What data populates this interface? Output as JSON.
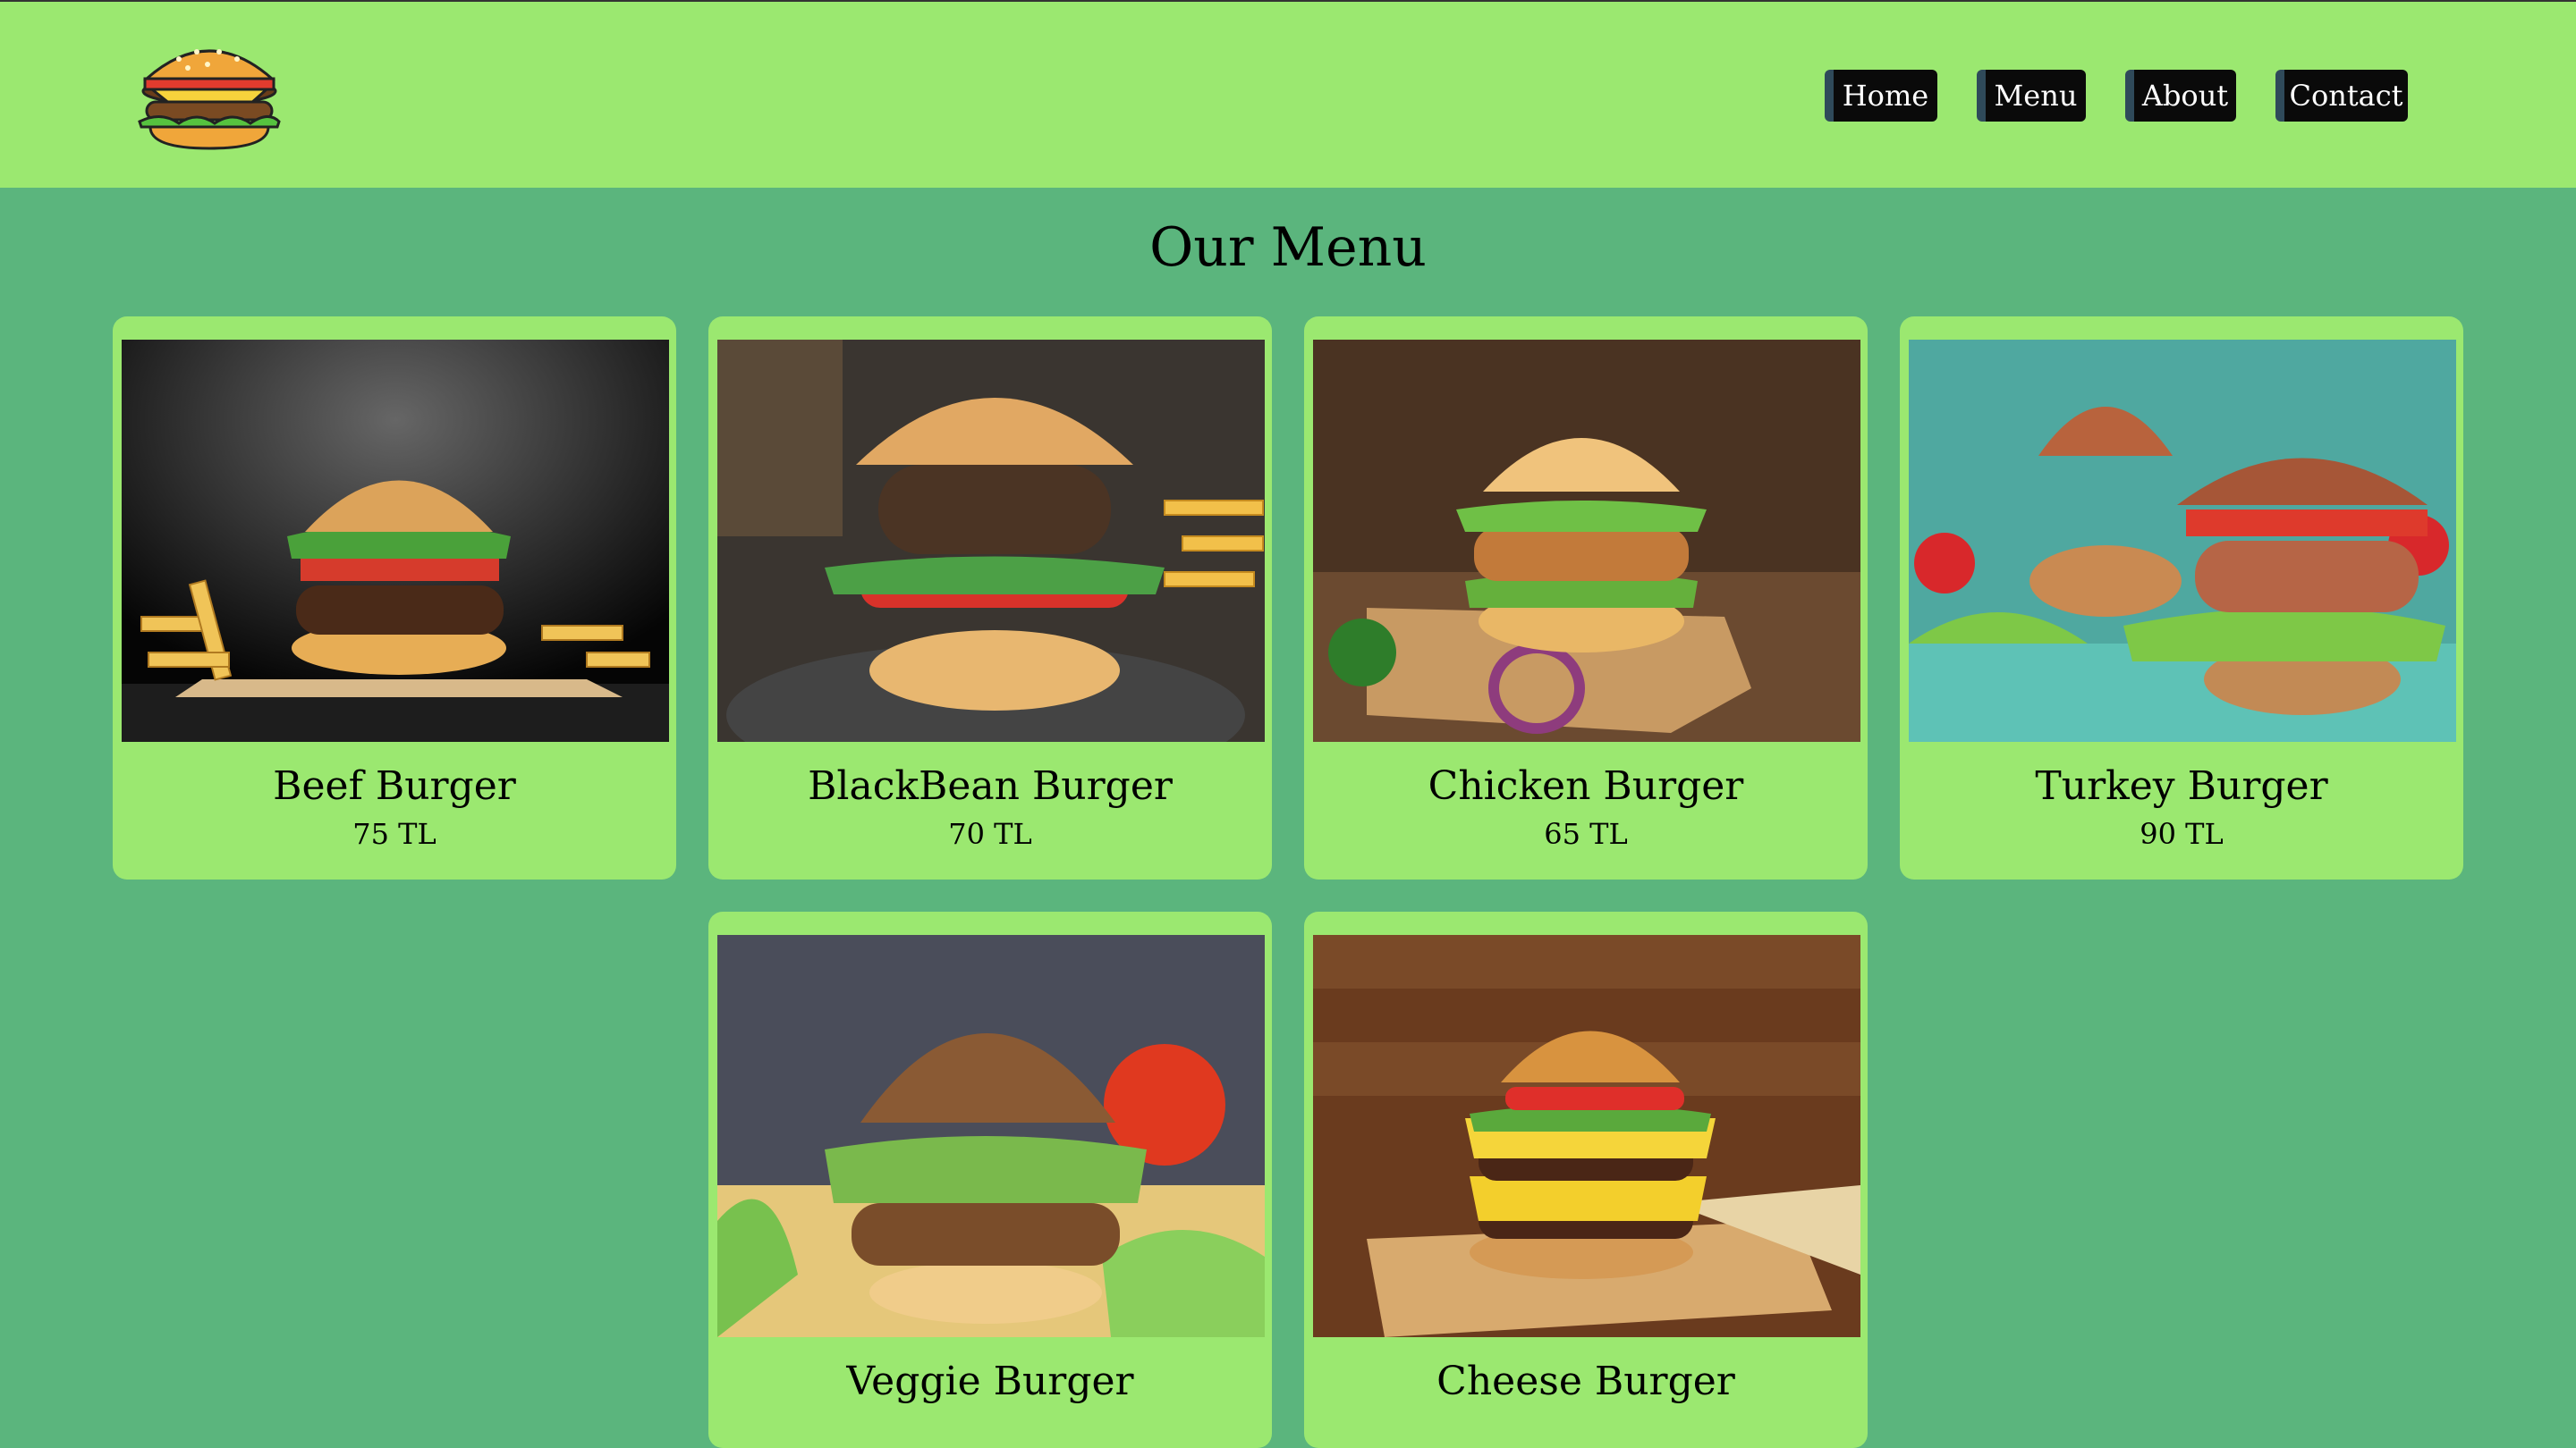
{
  "nav": {
    "items": [
      "Home",
      "Menu",
      "About",
      "Contact"
    ]
  },
  "page_title": "Our Menu",
  "menu": [
    {
      "name": "Beef Burger",
      "price": "75 TL"
    },
    {
      "name": "BlackBean Burger",
      "price": "70 TL"
    },
    {
      "name": "Chicken Burger",
      "price": "65 TL"
    },
    {
      "name": "Turkey Burger",
      "price": "90 TL"
    },
    {
      "name": "Veggie Burger",
      "price": ""
    },
    {
      "name": "Cheese Burger",
      "price": ""
    }
  ],
  "colors": {
    "header": "#9be870",
    "background": "#5bb57d",
    "card": "#9be870",
    "nav_bg": "#0a0a0a"
  }
}
